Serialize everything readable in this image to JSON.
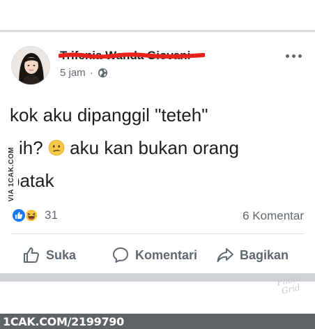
{
  "post": {
    "author": "Trifenia Wanda Giovani",
    "timestamp": "5 jam",
    "separator": "·",
    "text_line1": "kok aku dipanggil \"teteh\"",
    "text_line2a": "sih?",
    "text_line2b": "aku kan bukan orang",
    "text_line3": "batak",
    "emoji_icon": "confused-face-emoji"
  },
  "stats": {
    "reaction_count": "31",
    "comment_count": "6 Komentar",
    "reaction_icons": [
      "like-icon",
      "haha-icon"
    ]
  },
  "actions": {
    "like_label": "Suka",
    "comment_label": "Komentari",
    "share_label": "Bagikan"
  },
  "watermarks": {
    "side": "VIA 1CAK.COM",
    "corner": "Photo Grid",
    "footer": "1CAK.COM/2199790"
  },
  "colors": {
    "brand_blue": "#1877f2",
    "redaction_red": "#e8231d",
    "meta_gray": "#606770",
    "footer_bg": "#5f6266"
  }
}
